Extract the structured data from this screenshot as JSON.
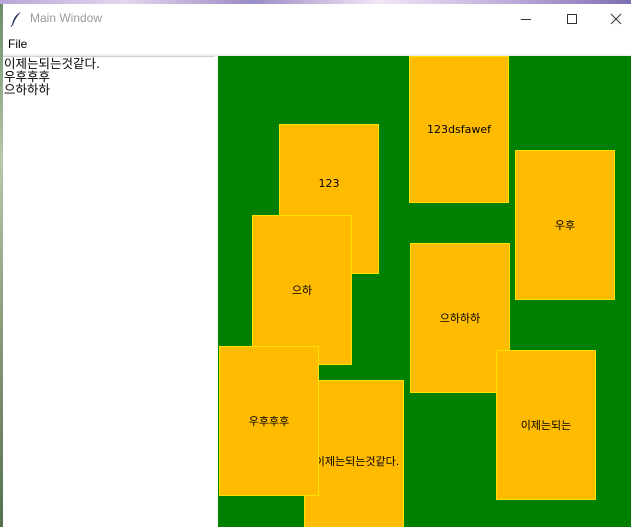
{
  "window": {
    "title": "Main Window"
  },
  "menu": {
    "file_label": "File"
  },
  "text_panel": {
    "lines": [
      "이제는되는것같다.",
      "우후후후",
      "으하하하"
    ]
  },
  "canvas": {
    "background_color": "#008000",
    "card_fill_color": "#ffbb00",
    "card_border_color": "#ffe000",
    "cards": [
      {
        "label": "123dsfawef"
      },
      {
        "label": "123"
      },
      {
        "label": "우후"
      },
      {
        "label": "으하"
      },
      {
        "label": "으하하하"
      },
      {
        "label": "우후후후"
      },
      {
        "label": "이제는되는"
      },
      {
        "label": "이제는되는것같다."
      }
    ]
  },
  "icons": [
    "feather-icon",
    "minimize-icon",
    "maximize-icon",
    "close-icon"
  ]
}
